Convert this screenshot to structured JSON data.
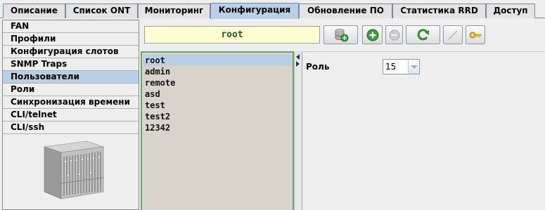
{
  "tabs": [
    {
      "label": "Описание",
      "active": false
    },
    {
      "label": "Список ONT",
      "active": false
    },
    {
      "label": "Мониторинг",
      "active": false
    },
    {
      "label": "Конфигурация",
      "active": true
    },
    {
      "label": "Обновление ПО",
      "active": false
    },
    {
      "label": "Статистика RRD",
      "active": false
    },
    {
      "label": "Доступ",
      "active": false
    }
  ],
  "sidebar": {
    "items": [
      {
        "label": "FAN",
        "selected": false
      },
      {
        "label": "Профили",
        "selected": false
      },
      {
        "label": "Конфигурация слотов",
        "selected": false
      },
      {
        "label": "SNMP Traps",
        "selected": false
      },
      {
        "label": "Пользователи",
        "selected": true
      },
      {
        "label": "Роли",
        "selected": false
      },
      {
        "label": "Синхронизация времени",
        "selected": false
      },
      {
        "label": "CLI/telnet",
        "selected": false
      },
      {
        "label": "CLI/ssh",
        "selected": false
      }
    ]
  },
  "toolbar": {
    "name_value": "root",
    "buttons": [
      {
        "icon": "database-refresh-icon",
        "enabled": true
      },
      {
        "icon": "add-icon",
        "enabled": true
      },
      {
        "icon": "remove-icon",
        "enabled": false
      },
      {
        "icon": "refresh-icon",
        "enabled": true
      },
      {
        "icon": "edit-icon",
        "enabled": false
      },
      {
        "icon": "key-icon",
        "enabled": true
      }
    ]
  },
  "users": {
    "items": [
      "root",
      "admin",
      "remote",
      "asd",
      "test",
      "test2",
      "12342"
    ],
    "selected": "root"
  },
  "properties": {
    "role_label": "Роль",
    "role_value": "15"
  },
  "colors": {
    "selection": "#b8cfe5",
    "list_background": "#d8d4cc",
    "list_border": "#6aa86a",
    "name_field_background": "#ffffd2"
  }
}
